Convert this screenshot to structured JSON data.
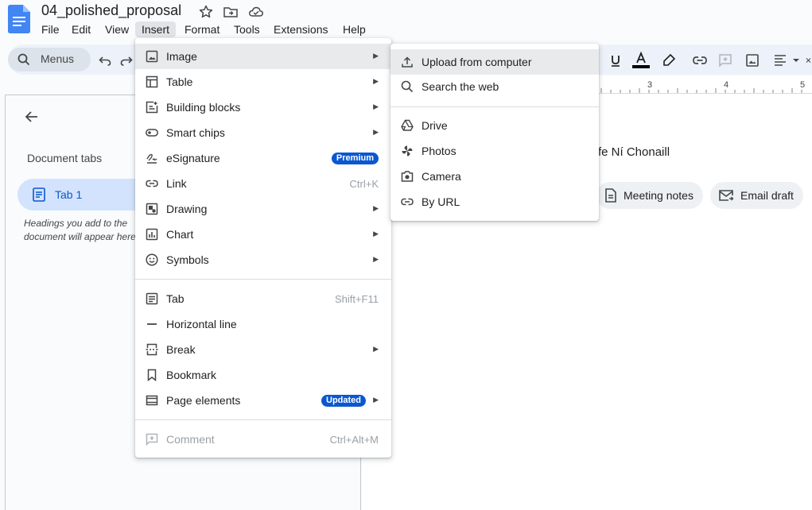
{
  "document": {
    "title": "04_polished_proposal"
  },
  "menubar": [
    "File",
    "Edit",
    "View",
    "Insert",
    "Format",
    "Tools",
    "Extensions",
    "Help"
  ],
  "toolbar": {
    "menus_label": "Menus"
  },
  "ruler": {
    "numbers": [
      "3",
      "4",
      "5"
    ]
  },
  "sidebar": {
    "heading": "Document tabs",
    "tab_label": "Tab 1",
    "hint": "Headings you add to the document will appear here."
  },
  "doc": {
    "author_fragment": "fe Ní Chonaill",
    "chips": [
      "Meeting notes",
      "Email draft"
    ]
  },
  "insert_menu": {
    "items": [
      {
        "label": "Image",
        "icon": "image-icon",
        "submenu": true
      },
      {
        "label": "Table",
        "icon": "table-icon",
        "submenu": true
      },
      {
        "label": "Building blocks",
        "icon": "building-blocks-icon",
        "submenu": true
      },
      {
        "label": "Smart chips",
        "icon": "smart-chips-icon",
        "submenu": true
      },
      {
        "label": "eSignature",
        "icon": "signature-icon",
        "badge": "Premium"
      },
      {
        "label": "Link",
        "icon": "link-icon",
        "shortcut": "Ctrl+K"
      },
      {
        "label": "Drawing",
        "icon": "drawing-icon",
        "submenu": true
      },
      {
        "label": "Chart",
        "icon": "chart-icon",
        "submenu": true
      },
      {
        "label": "Symbols",
        "icon": "smiley-icon",
        "submenu": true
      },
      {
        "label": "Tab",
        "icon": "tab-icon",
        "shortcut": "Shift+F11"
      },
      {
        "label": "Horizontal line",
        "icon": "horizontal-line-icon"
      },
      {
        "label": "Break",
        "icon": "break-icon",
        "submenu": true
      },
      {
        "label": "Bookmark",
        "icon": "bookmark-icon"
      },
      {
        "label": "Page elements",
        "icon": "page-elements-icon",
        "badge": "Updated",
        "submenu": true
      },
      {
        "label": "Comment",
        "icon": "comment-icon",
        "shortcut": "Ctrl+Alt+M",
        "disabled": true
      }
    ]
  },
  "image_submenu": {
    "items": [
      {
        "label": "Upload from computer",
        "icon": "upload-icon"
      },
      {
        "label": "Search the web",
        "icon": "search-icon"
      },
      {
        "label": "Drive",
        "icon": "drive-icon"
      },
      {
        "label": "Photos",
        "icon": "photos-icon"
      },
      {
        "label": "Camera",
        "icon": "camera-icon"
      },
      {
        "label": "By URL",
        "icon": "link-icon"
      }
    ]
  },
  "colors": {
    "accent": "#0b57d0",
    "text_color_bar": "#000000"
  }
}
